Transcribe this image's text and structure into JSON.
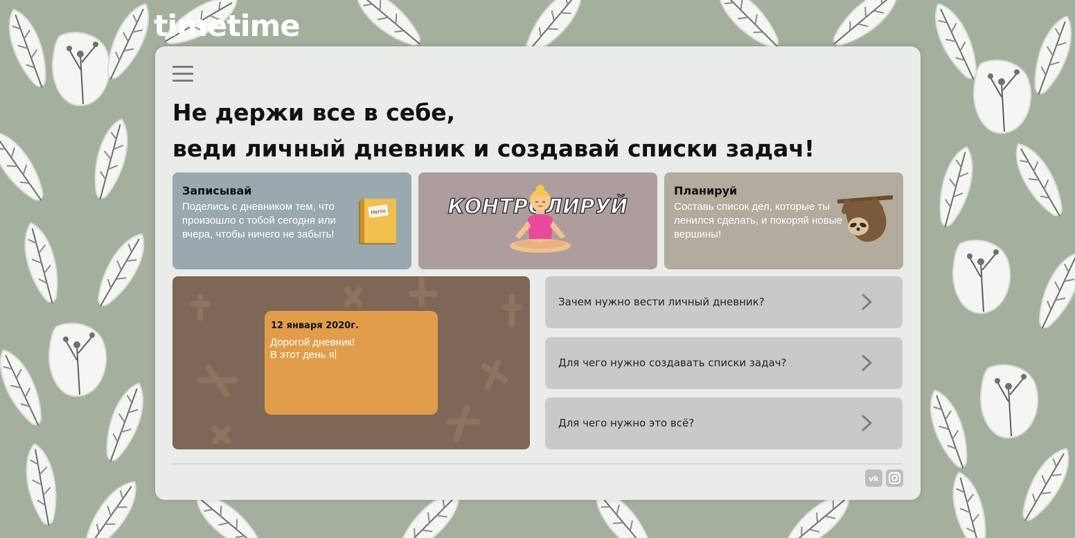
{
  "brand": {
    "logo": "timetime"
  },
  "headline": {
    "line1": "Не держи все в себе,",
    "line2": "веди личный дневник и создавай списки задач!"
  },
  "cards": [
    {
      "title": "Записывай",
      "text": "Поделись с дневником тем, что произошло с тобой сегодня или вчера, чтобы ничего не забыть!",
      "icon": "notebook-icon",
      "icon_label": "Memo",
      "color": "#9aa9b0"
    },
    {
      "big_text": "Контролируй",
      "icon": "meditating-woman-icon",
      "color": "#ad9e9d"
    },
    {
      "title": "Планируй",
      "text": "Составь список дел, которые ты ленился сделать, и покоряй новые вершины!",
      "icon": "sloth-icon",
      "color": "#b2ab9e"
    }
  ],
  "diary": {
    "date": "12 января 2020г.",
    "line1": "Дорогой дневник!",
    "line2": "В этот день я",
    "background_color": "#7e6756",
    "note_color": "#e29d4b"
  },
  "faq": [
    {
      "label": "Зачем нужно вести личный дневник?"
    },
    {
      "label": "Для чего нужно создавать списки задач?"
    },
    {
      "label": "Для чего нужно это всё?"
    }
  ],
  "social": [
    {
      "icon": "vk-icon",
      "text": "vk"
    },
    {
      "icon": "instagram-icon"
    }
  ],
  "colors": {
    "page_background": "#a3b09d",
    "panel_background": "#eaecea",
    "faq_background": "#c9c9c9"
  }
}
